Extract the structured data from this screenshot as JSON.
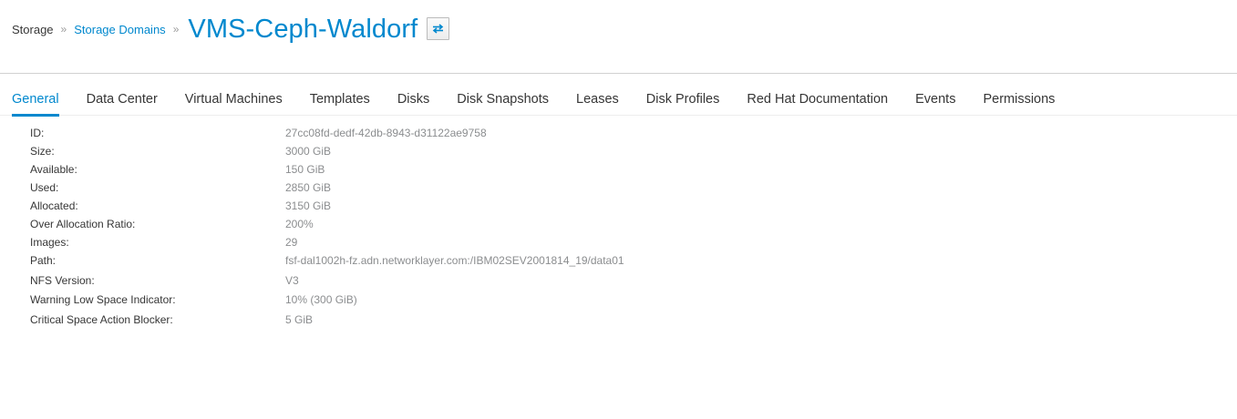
{
  "breadcrumb": {
    "root": "Storage",
    "separator": "»",
    "parent": "Storage Domains",
    "separator2": "»"
  },
  "title": "VMS-Ceph-Waldorf",
  "switch_icon": "switch-arrows-icon",
  "tabs": [
    {
      "label": "General",
      "active": true
    },
    {
      "label": "Data Center"
    },
    {
      "label": "Virtual Machines"
    },
    {
      "label": "Templates"
    },
    {
      "label": "Disks"
    },
    {
      "label": "Disk Snapshots"
    },
    {
      "label": "Leases"
    },
    {
      "label": "Disk Profiles"
    },
    {
      "label": "Red Hat Documentation"
    },
    {
      "label": "Events"
    },
    {
      "label": "Permissions"
    }
  ],
  "details": [
    {
      "label": "ID:",
      "value": "27cc08fd-dedf-42db-8943-d31122ae9758"
    },
    {
      "label": "Size:",
      "value": "3000 GiB"
    },
    {
      "label": "Available:",
      "value": "150 GiB"
    },
    {
      "label": "Used:",
      "value": "2850 GiB"
    },
    {
      "label": "Allocated:",
      "value": "3150 GiB"
    },
    {
      "label": "Over Allocation Ratio:",
      "value": "200%"
    },
    {
      "label": "Images:",
      "value": "29"
    },
    {
      "label": "Path:",
      "value": "fsf-dal1002h-fz.adn.networklayer.com:/IBM02SEV2001814_19/data01"
    },
    {
      "label": "NFS Version:",
      "value": "V3"
    },
    {
      "label": "Warning Low Space Indicator:",
      "value": "10% (300 GiB)"
    },
    {
      "label": "Critical Space Action Blocker:",
      "value": "5 GiB"
    }
  ],
  "colors": {
    "accent": "#0088ce",
    "text": "#363636",
    "muted": "#8b8d8f"
  }
}
